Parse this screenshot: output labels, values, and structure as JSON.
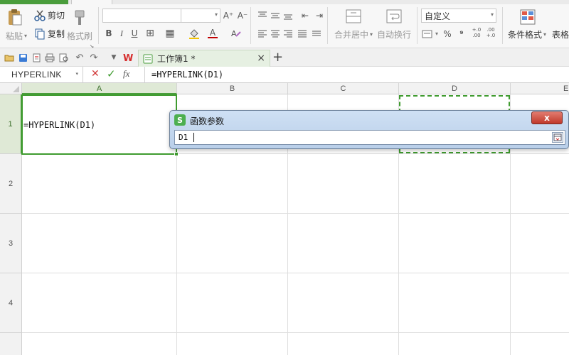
{
  "ribbon": {
    "cut_label": "剪切",
    "copy_label": "复制",
    "paste_label": "粘贴",
    "format_painter_label": "格式刷",
    "merge_center_label": "合并居中",
    "wrap_text_label": "自动换行",
    "number_format_value": "自定义",
    "conditional_format_label": "条件格式",
    "table_format_label": "表格样",
    "font_bold": "B",
    "font_italic": "I",
    "font_underline": "U",
    "percent_symbol": "%",
    "comma_symbol": "⁹",
    "increase_decimal": "+.0 .00",
    "decrease_decimal": ".00 +.0",
    "grow_font": "A⁺",
    "shrink_font": "A⁻",
    "font_color_letter": "A"
  },
  "tabs": {
    "document_title": "工作簿1 *",
    "close_symbol": "×",
    "add_symbol": "+"
  },
  "formula_bar": {
    "name_box_value": "HYPERLINK",
    "cancel_symbol": "✕",
    "confirm_symbol": "✓",
    "fx_label": "fx",
    "formula_value": "=HYPERLINK(D1)"
  },
  "grid": {
    "columns": [
      "A",
      "B",
      "C",
      "D",
      "E"
    ],
    "rows": [
      "1",
      "2",
      "3",
      "4"
    ],
    "cell_a1_value": "=HYPERLINK(D1)"
  },
  "dialog": {
    "title": "函数参数",
    "input_value": "D1",
    "close_symbol": "x",
    "app_badge": "S"
  },
  "colors": {
    "accent_green": "#4a9d3c",
    "selection_border": "#3f9b2f",
    "dialog_title_bg": "#c4d7ef",
    "close_button_red": "#c9463d"
  }
}
